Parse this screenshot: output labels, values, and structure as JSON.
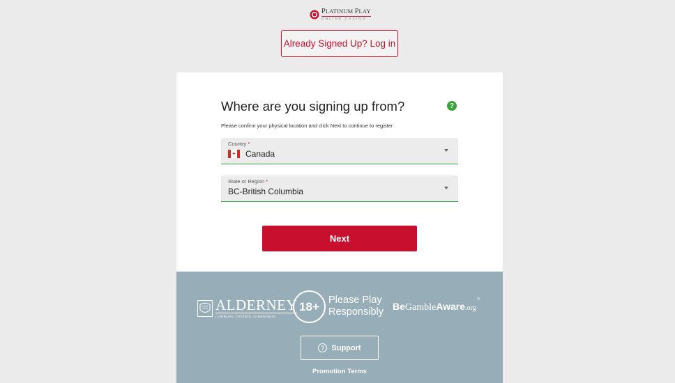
{
  "brand": {
    "top_first": "P",
    "top_rest": "LATINUM ",
    "top_first2": "P",
    "top_rest2": "LAY",
    "bottom": "ONLINE CASINO"
  },
  "header": {
    "login_label": "Already Signed Up? Log in"
  },
  "form": {
    "title": "Where are you signing up from?",
    "subtitle": "Please confirm your physical location and click Next to continue to register",
    "help_glyph": "?",
    "country": {
      "label": "Country",
      "required_mark": "*",
      "value": "Canada",
      "flag_icon": "canada-flag-icon"
    },
    "region": {
      "label": "State or Region",
      "required_mark": "*",
      "value": "BC-British Columbia"
    },
    "next_label": "Next"
  },
  "footer": {
    "alderney_name": "ALDERNEY",
    "alderney_sub": "GAMBLING CONTROL COMMISSION",
    "age": "18+",
    "responsible_line1": "Please Play",
    "responsible_line2": "Responsibly",
    "gamble_aware_be": "Be",
    "gamble_aware_gamble": "Gamble",
    "gamble_aware_aware": "Aware",
    "gamble_aware_org": ".org",
    "gamble_aware_reg": "®",
    "support_icon_glyph": "?",
    "support_label": "Support",
    "promo_label": "Promotion Terms"
  },
  "colors": {
    "accent": "#c8102e",
    "success": "#3aa43c",
    "footer_bg": "#97adb7",
    "page_bg": "#ebebeb"
  }
}
